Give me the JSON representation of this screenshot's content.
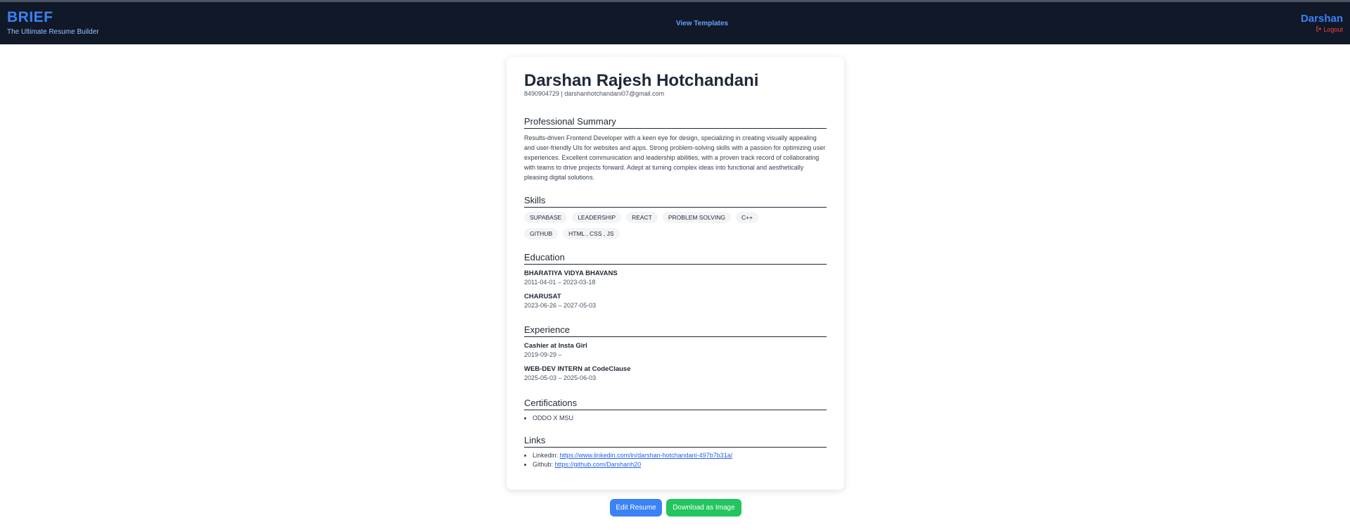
{
  "navbar": {
    "brand_title": "BRIEF",
    "brand_subtitle": "The Ultimate Resume Builder",
    "center_link": "View Templates",
    "username": "Darshan",
    "logout_label": "Logout",
    "logout_icon": "logout-icon"
  },
  "resume": {
    "name": "Darshan Rajesh Hotchandani",
    "contact": "8490904729  |  darshanhotchandani07@gmail.com",
    "summary_title": "Professional Summary",
    "summary": "Results-driven Frontend Developer with a keen eye for design, specializing in creating visually appealing and user-friendly UIs for websites and apps. Strong problem-solving skills with a passion for optimizing user experiences. Excellent communication and leadership abilities, with a proven track record of collaborating with teams to drive projects forward. Adept at turning complex ideas into functional and aesthetically pleasing digital solutions.",
    "skills_title": "Skills",
    "skills": [
      "SUPABASE",
      "LEADERSHIP",
      "REACT",
      "PROBLEM SOLVING",
      "C++",
      "GITHUB",
      "HTML , CSS , JS"
    ],
    "education_title": "Education",
    "education": [
      {
        "school": "BHARATIYA VIDYA BHAVANS",
        "dates": "2011-04-01 – 2023-03-18"
      },
      {
        "school": "CHARUSAT",
        "dates": "2023-06-26 – 2027-05-03"
      }
    ],
    "experience_title": "Experience",
    "experience": [
      {
        "role": "Cashier at Insta Girl",
        "dates": "2019-09-29 –"
      },
      {
        "role": "WEB-DEV INTERN at CodeClause",
        "dates": "2025-05-03 – 2025-06-03"
      }
    ],
    "certifications_title": "Certifications",
    "certifications": [
      "ODDO X MSU"
    ],
    "links_title": "Links",
    "links": [
      {
        "label": "Linkedin:",
        "url": "https://www.linkedin.com/in/darshan-hotchandani-497b7b31a/"
      },
      {
        "label": "Github:",
        "url": "https://github.com/Darshanh20"
      }
    ]
  },
  "actions": {
    "edit_label": "Edit Resume",
    "download_label": "Download as Image"
  },
  "colors": {
    "navbar_bg": "#111827",
    "brand": "#3b82f6",
    "logout": "#ef4444",
    "edit_button": "#3b82f6",
    "download_button": "#22c55e"
  }
}
